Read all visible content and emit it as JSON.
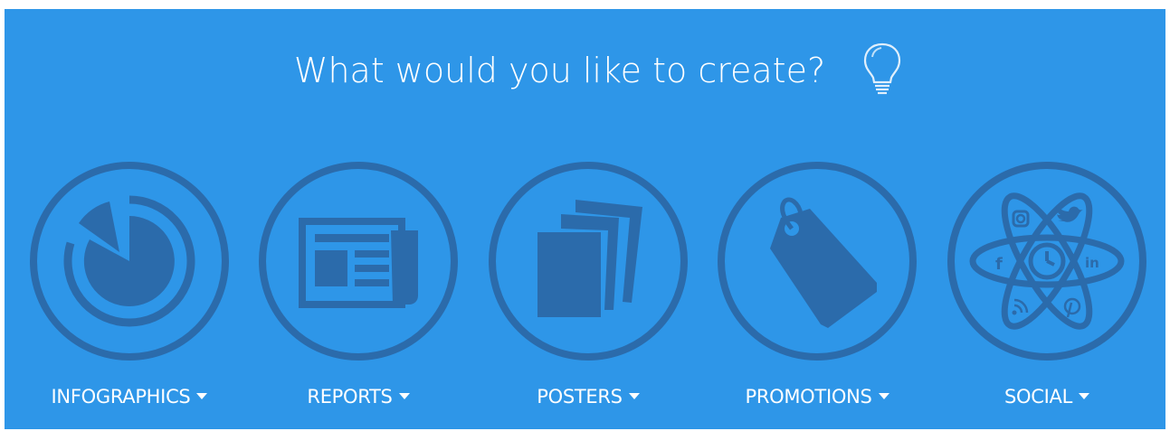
{
  "header": {
    "title": "What would you like to create?",
    "icon": "lightbulb-icon"
  },
  "colors": {
    "background": "#2e96e8",
    "icon": "#2b6bab",
    "text": "#ffffff"
  },
  "options": [
    {
      "label": "INFOGRAPHICS",
      "icon": "pie-chart-icon"
    },
    {
      "label": "REPORTS",
      "icon": "newspaper-icon"
    },
    {
      "label": "POSTERS",
      "icon": "posters-icon"
    },
    {
      "label": "PROMOTIONS",
      "icon": "price-tag-icon"
    },
    {
      "label": "SOCIAL",
      "icon": "social-atom-icon"
    }
  ]
}
